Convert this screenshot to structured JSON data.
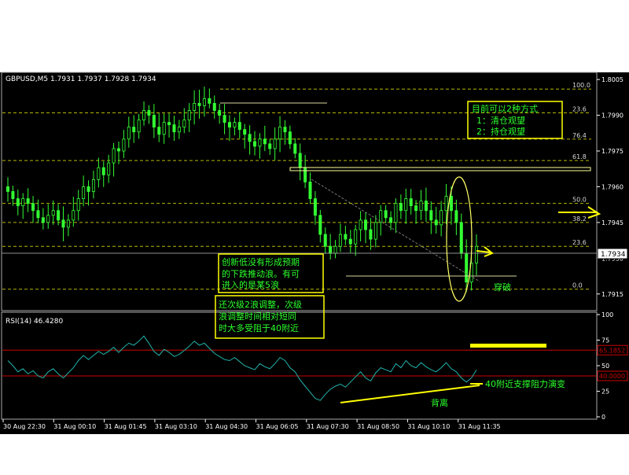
{
  "symbol_header": "GBPUSD,M5  1.7931 1.7937 1.7928 1.7934",
  "current_price_label": "1.7934",
  "price_axis": {
    "min": 1.7908,
    "max": 1.8008,
    "ticks": [
      "1.8005",
      "1.7990",
      "1.7975",
      "1.7960",
      "1.7945",
      "1.7930",
      "1.7915"
    ]
  },
  "time_axis": {
    "ticks": [
      "30 Aug 22:30",
      "31 Aug 00:10",
      "31 Aug 01:45",
      "31 Aug 03:10",
      "31 Aug 04:30",
      "31 Aug 06:05",
      "31 Aug 07:30",
      "31 Aug 08:50",
      "31 Aug 10:10",
      "31 Aug 11:35"
    ]
  },
  "fibonacci": {
    "levels": [
      {
        "label": "100.0",
        "price": 1.8001
      },
      {
        "label": "23.6",
        "price": 1.7991
      },
      {
        "label": "76.4",
        "price": 1.798
      },
      {
        "label": "61.8",
        "price": 1.7971
      },
      {
        "label": "50.0",
        "price": 1.7953
      },
      {
        "label": "38.2",
        "price": 1.7945
      },
      {
        "label": "23.6",
        "price": 1.7935
      },
      {
        "label": "0.0",
        "price": 1.7917
      }
    ]
  },
  "rsi_panel": {
    "header": "RSI(14)  46.4280",
    "ticks": [
      "100",
      "75",
      "50",
      "25",
      "0"
    ],
    "levels": [
      {
        "label": "65.1852",
        "value": 65.1852
      },
      {
        "label": "40.0000",
        "value": 40
      }
    ]
  },
  "annotations": {
    "top_right_box": [
      "目前可以2种方式",
      "1：清仓观望",
      "2：持仓观望"
    ],
    "mid_box": [
      "创新低没有形成预期",
      "的下跌推动浪。有可",
      "进入的是某5浪"
    ],
    "lower_box": [
      "还次级2浪调整，次级",
      "浪调整时间相对短同",
      "时大多受阻于40附近"
    ],
    "breakout_label": "穿破",
    "divergence_label": "背离",
    "rsi_note": "40附近支撑阻力演变"
  },
  "chart_data": {
    "type": "candlestick",
    "title": "GBPUSD,M5",
    "timeframe": "M5",
    "ohlc_header": {
      "open": 1.7931,
      "high": 1.7937,
      "low": 1.7928,
      "close": 1.7934
    },
    "ylim": [
      1.7908,
      1.8008
    ],
    "x_tick_labels": [
      "30 Aug 22:30",
      "31 Aug 00:10",
      "31 Aug 01:45",
      "31 Aug 03:10",
      "31 Aug 04:30",
      "31 Aug 06:05",
      "31 Aug 07:30",
      "31 Aug 08:50",
      "31 Aug 10:10",
      "31 Aug 11:35"
    ],
    "close_path": [
      1.7958,
      1.7955,
      1.7952,
      1.7955,
      1.7953,
      1.795,
      1.7947,
      1.7945,
      1.7948,
      1.795,
      1.7946,
      1.7943,
      1.7946,
      1.795,
      1.7955,
      1.796,
      1.7958,
      1.7963,
      1.7968,
      1.7965,
      1.797,
      1.7976,
      1.7975,
      1.798,
      1.7985,
      1.7983,
      1.7988,
      1.7992,
      1.799,
      1.7985,
      1.7982,
      1.7987,
      1.7986,
      1.7983,
      1.7985,
      1.7988,
      1.7992,
      1.7995,
      1.7994,
      1.7997,
      1.7995,
      1.7992,
      1.799,
      1.7987,
      1.7985,
      1.7987,
      1.7984,
      1.7982,
      1.7979,
      1.7977,
      1.798,
      1.7978,
      1.7976,
      1.798,
      1.7985,
      1.7983,
      1.7978,
      1.7974,
      1.7968,
      1.7962,
      1.7955,
      1.7948,
      1.794,
      1.7935,
      1.7932,
      1.7935,
      1.794,
      1.7938,
      1.7936,
      1.7942,
      1.7946,
      1.7942,
      1.7938,
      1.7945,
      1.795,
      1.7947,
      1.7945,
      1.7953,
      1.795,
      1.7955,
      1.7952,
      1.795,
      1.7954,
      1.795,
      1.7946,
      1.7944,
      1.795,
      1.7956,
      1.795,
      1.7945,
      1.7932,
      1.792,
      1.7928,
      1.7935
    ],
    "rsi": {
      "name": "RSI(14)",
      "last": 46.428,
      "levels": [
        65.1852,
        40
      ],
      "ylim": [
        0,
        100
      ],
      "values": [
        55,
        50,
        44,
        47,
        42,
        45,
        40,
        38,
        44,
        47,
        42,
        38,
        43,
        48,
        55,
        60,
        56,
        60,
        64,
        61,
        64,
        68,
        63,
        68,
        72,
        70,
        74,
        79,
        72,
        64,
        60,
        66,
        63,
        59,
        61,
        65,
        69,
        74,
        70,
        72,
        67,
        62,
        59,
        56,
        55,
        58,
        54,
        50,
        48,
        46,
        52,
        49,
        47,
        52,
        58,
        55,
        48,
        44,
        36,
        30,
        24,
        18,
        16,
        22,
        27,
        30,
        32,
        29,
        34,
        39,
        44,
        38,
        35,
        43,
        48,
        46,
        44,
        52,
        48,
        55,
        50,
        48,
        53,
        49,
        46,
        44,
        48,
        53,
        47,
        44,
        38,
        34,
        38,
        46
      ]
    }
  }
}
